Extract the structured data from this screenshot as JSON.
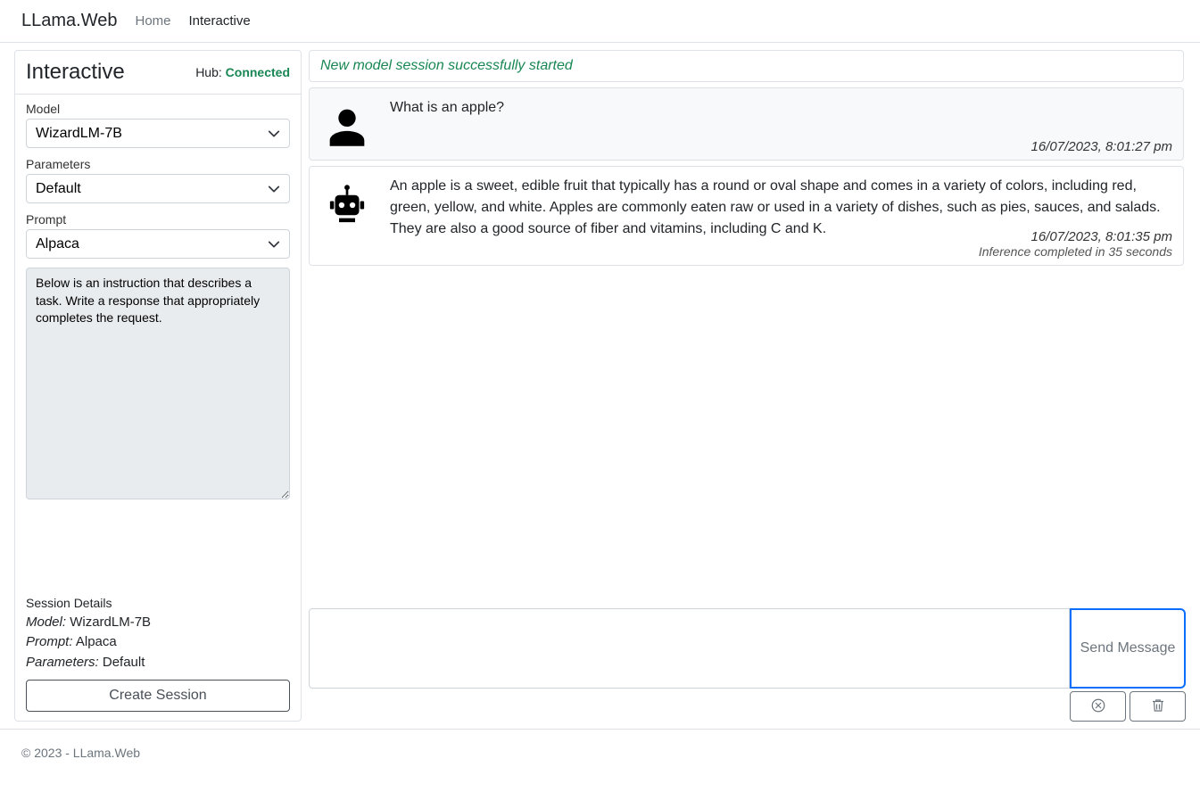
{
  "navbar": {
    "brand": "LLama.Web",
    "links": [
      {
        "label": "Home"
      },
      {
        "label": "Interactive"
      }
    ]
  },
  "sidebar": {
    "title": "Interactive",
    "hub_label": "Hub:",
    "hub_status": "Connected",
    "model_label": "Model",
    "model_value": "WizardLM-7B",
    "parameters_label": "Parameters",
    "parameters_value": "Default",
    "prompt_label": "Prompt",
    "prompt_value": "Alpaca",
    "prompt_text": "Below is an instruction that describes a task. Write a response that appropriately completes the request.",
    "session_details_title": "Session Details",
    "session_details": {
      "model_k": "Model:",
      "model_v": "WizardLM-7B",
      "prompt_k": "Prompt:",
      "prompt_v": "Alpaca",
      "parameters_k": "Parameters:",
      "parameters_v": "Default"
    },
    "create_session_label": "Create Session"
  },
  "chat": {
    "banner": "New model session successfully started",
    "messages": [
      {
        "role": "user",
        "text": "What is an apple?",
        "time": "16/07/2023, 8:01:27 pm"
      },
      {
        "role": "bot",
        "text": "An apple is a sweet, edible fruit that typically has a round or oval shape and comes in a variety of colors, including red, green, yellow, and white. Apples are commonly eaten raw or used in a variety of dishes, such as pies, sauces, and salads. They are also a good source of fiber and vitamins, including C and K.",
        "time": "16/07/2023, 8:01:35 pm",
        "meta": "Inference completed in 35 seconds"
      }
    ],
    "input_placeholder": "",
    "send_label": "Send Message"
  },
  "footer": {
    "text": "© 2023 - LLama.Web"
  }
}
